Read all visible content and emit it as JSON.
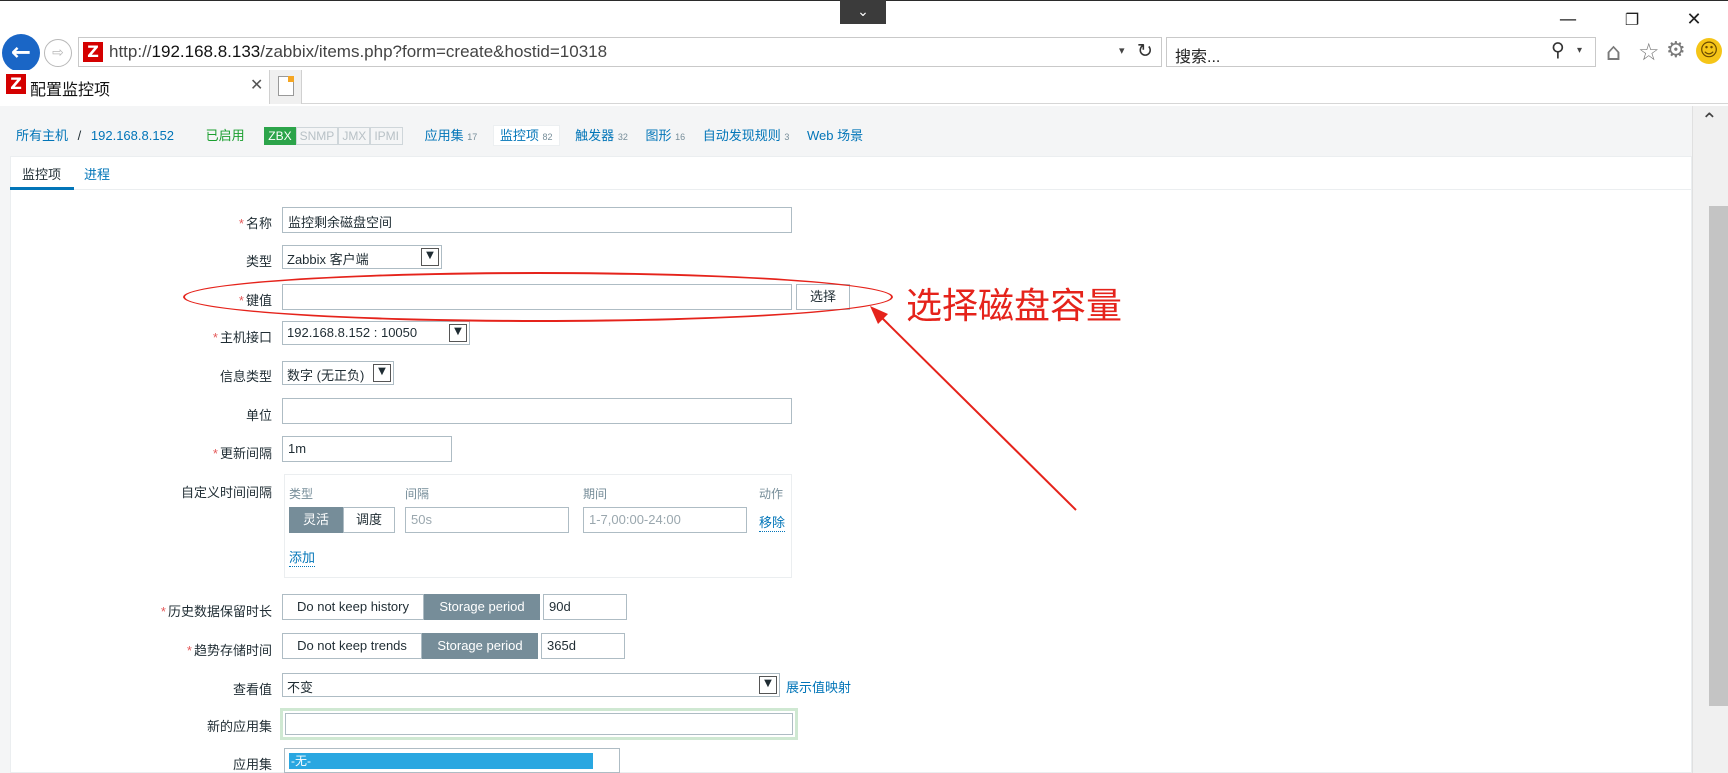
{
  "browser": {
    "url_prefix": "http://",
    "url_host": "192.168.8.133",
    "url_path": "/zabbix/items.php?form=create&hostid=10318",
    "search_placeholder": "搜索...",
    "tab_title": "配置监控项",
    "logo_letter": "Z",
    "window_buttons": {
      "minimize": "—",
      "restore": "❐",
      "close": "✕"
    },
    "icons": [
      "back-arrow-icon",
      "forward-icon",
      "refresh-icon",
      "search-icon",
      "home-icon",
      "star-icon",
      "gear-icon",
      "smiley-icon"
    ]
  },
  "breadcrumb": {
    "all_hosts": "所有主机",
    "separator": "/",
    "host": "192.168.8.152",
    "status": "已启用",
    "badges": [
      {
        "label": "ZBX",
        "active": true
      },
      {
        "label": "SNMP",
        "active": false
      },
      {
        "label": "JMX",
        "active": false
      },
      {
        "label": "IPMI",
        "active": false
      }
    ],
    "nav": [
      {
        "label": "应用集",
        "count": "17"
      },
      {
        "label": "监控项",
        "count": "82",
        "selected": true
      },
      {
        "label": "触发器",
        "count": "32"
      },
      {
        "label": "图形",
        "count": "16"
      },
      {
        "label": "自动发现规则",
        "count": "3"
      },
      {
        "label": "Web 场景",
        "count": ""
      }
    ]
  },
  "form_tabs": [
    "监控项",
    "进程"
  ],
  "form": {
    "name": {
      "label": "名称",
      "value": "监控剩余磁盘空间"
    },
    "type": {
      "label": "类型",
      "value": "Zabbix 客户端"
    },
    "key": {
      "label": "键值",
      "value": "",
      "button": "选择"
    },
    "interface": {
      "label": "主机接口",
      "value": "192.168.8.152 : 10050"
    },
    "info_type": {
      "label": "信息类型",
      "value": "数字 (无正负)"
    },
    "unit": {
      "label": "单位",
      "value": ""
    },
    "update_interval": {
      "label": "更新间隔",
      "value": "1m"
    },
    "custom_intervals": {
      "label": "自定义时间间隔",
      "col_type": "类型",
      "col_interval": "间隔",
      "col_period": "期间",
      "col_action": "动作",
      "flexible": "灵活",
      "scheduling": "调度",
      "interval_placeholder": "50s",
      "period_placeholder": "1-7,00:00-24:00",
      "remove": "移除",
      "add": "添加"
    },
    "history": {
      "label": "历史数据保留时长",
      "opt1": "Do not keep history",
      "opt2": "Storage period",
      "value": "90d"
    },
    "trends": {
      "label": "趋势存储时间",
      "opt1": "Do not keep trends",
      "opt2": "Storage period",
      "value": "365d"
    },
    "show_value": {
      "label": "查看值",
      "value": "不变",
      "link": "展示值映射"
    },
    "new_application": {
      "label": "新的应用集",
      "value": ""
    },
    "applications": {
      "label": "应用集",
      "selected": "-无-"
    },
    "required_mark": "*"
  },
  "annotation": {
    "text": "选择磁盘容量",
    "color": "#e5231b"
  },
  "colors": {
    "link": "#0275b8",
    "enabled": "#1a9f2f",
    "badge_on": "#2ca44a",
    "seg_on": "#768d99",
    "list_select": "#29a7e1"
  }
}
